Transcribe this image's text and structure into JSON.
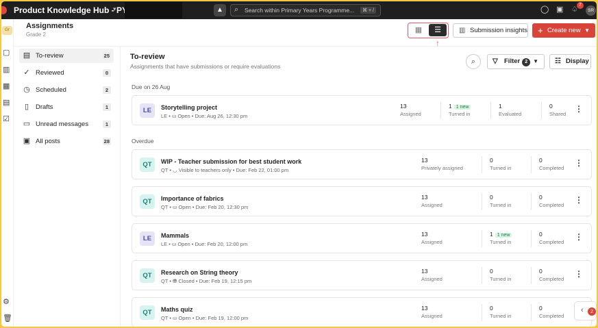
{
  "topbar": {
    "title": "Product Knowledge Hub - PYP",
    "search_placeholder": "Search within Primary Years Programme...",
    "search_shortcut": "⌘ + /",
    "notification_count": "7",
    "avatar_initials": "SR"
  },
  "rail": {
    "badge": "Gr"
  },
  "header": {
    "title": "Assignments",
    "subtitle": "Grade 2",
    "insights_label": "Submission insights",
    "create_label": "Create new"
  },
  "sidebar": {
    "items": [
      {
        "label": "To-review",
        "count": "25",
        "icon": "review-icon"
      },
      {
        "label": "Reviewed",
        "count": "0",
        "icon": "check-circle-icon"
      },
      {
        "label": "Scheduled",
        "count": "2",
        "icon": "clock-icon"
      },
      {
        "label": "Drafts",
        "count": "1",
        "icon": "file-icon"
      },
      {
        "label": "Unread messages",
        "count": "1",
        "icon": "message-icon"
      },
      {
        "label": "All posts",
        "count": "28",
        "icon": "posts-icon"
      }
    ]
  },
  "main": {
    "title": "To-review",
    "subtitle": "Assignments that have submissions or require evaluations",
    "filter_label": "Filter",
    "filter_count": "2",
    "display_label": "Display",
    "sections": [
      {
        "heading": "Due on 26 Aug",
        "cards": [
          {
            "tag": "LE",
            "title": "Storytelling project",
            "meta": "LE • ⛀ Open • Due: Aug 26, 12:30 pm",
            "stats": [
              {
                "num": "13",
                "label": "Assigned"
              },
              {
                "num": "1",
                "label": "Turned in",
                "badge": "1 new"
              },
              {
                "num": "1",
                "label": "Evaluated"
              },
              {
                "num": "0",
                "label": "Shared"
              }
            ]
          }
        ]
      },
      {
        "heading": "Overdue",
        "cards": [
          {
            "tag": "QT",
            "title": "WIP - Teacher submission for best student work",
            "meta": "QT • ◡ Visible to teachers only • Due: Feb 22, 01:00 pm",
            "stats": [
              {
                "num": "13",
                "label": "Privately assigned"
              },
              {
                "num": "0",
                "label": "Turned in"
              },
              {
                "num": "0",
                "label": "Completed"
              }
            ]
          },
          {
            "tag": "QT",
            "title": "Importance of fabrics",
            "meta": "QT • ⛀ Open • Due: Feb 20, 12:30 pm",
            "stats": [
              {
                "num": "13",
                "label": "Assigned"
              },
              {
                "num": "0",
                "label": "Turned in"
              },
              {
                "num": "0",
                "label": "Completed"
              }
            ]
          },
          {
            "tag": "LE",
            "title": "Mammals",
            "meta": "LE • ⛀ Open • Due: Feb 20, 12:00 pm",
            "stats": [
              {
                "num": "13",
                "label": "Assigned"
              },
              {
                "num": "1",
                "label": "Turned in",
                "badge": "1 new"
              },
              {
                "num": "0",
                "label": "Completed"
              }
            ]
          },
          {
            "tag": "QT",
            "title": "Research on String theory",
            "meta": "QT • ⛃ Closed • Due: Feb 19, 12:15 pm",
            "stats": [
              {
                "num": "13",
                "label": "Assigned"
              },
              {
                "num": "0",
                "label": "Turned in"
              },
              {
                "num": "0",
                "label": "Completed"
              }
            ]
          },
          {
            "tag": "QT",
            "title": "Maths quiz",
            "meta": "QT • ⛀ Open • Due: Feb 19, 12:00 pm",
            "stats": [
              {
                "num": "13",
                "label": "Assigned"
              },
              {
                "num": "0",
                "label": "Turned in"
              },
              {
                "num": "0",
                "label": "Completed"
              }
            ]
          }
        ]
      }
    ]
  },
  "floating": {
    "count": "2"
  },
  "colors": {
    "accent": "#d9443a",
    "highlight_outline": "#e05a6a",
    "topbar": "#1f1f1f",
    "new_badge": "#d9f3e4"
  }
}
